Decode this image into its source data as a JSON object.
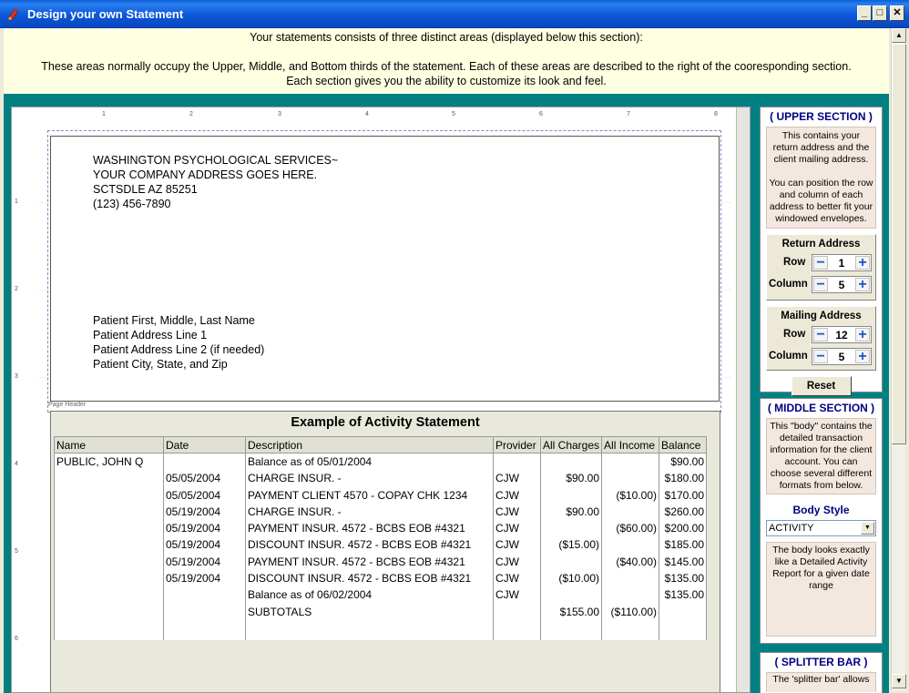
{
  "window": {
    "title": "Design your own Statement",
    "controls": {
      "minimize": "_",
      "maximize": "□",
      "close": "✕"
    }
  },
  "intro": {
    "line1": "Your statements consists of three distinct areas (displayed below this section):",
    "line2": "These areas normally occupy the Upper, Middle, and Bottom thirds of the statement.  Each of these areas are described to the right of the cooresponding section.",
    "line3": "Each section gives you the ability to customize its look and feel."
  },
  "rulers": {
    "horizontal": [
      "1",
      "2",
      "3",
      "4",
      "5",
      "6",
      "7",
      "8"
    ],
    "vertical": [
      "1",
      "2",
      "3",
      "4",
      "5",
      "6"
    ]
  },
  "header": {
    "return_address": [
      "WASHINGTON PSYCHOLOGICAL SERVICES~",
      "YOUR COMPANY ADDRESS GOES HERE.",
      "SCTSDLE AZ 85251",
      "(123) 456-7890"
    ],
    "mailing_address": [
      "Patient First, Middle, Last Name",
      "Patient Address Line 1",
      "Patient Address Line 2 (if needed)",
      "Patient City, State, and Zip"
    ],
    "page_header_label": "Page Header"
  },
  "activity": {
    "title": "Example of Activity Statement",
    "columns": [
      "Name",
      "Date",
      "Description",
      "Provider",
      "All Charges",
      "All Income",
      "Balance"
    ],
    "rows": [
      [
        "PUBLIC, JOHN Q",
        "",
        "Balance as of 05/01/2004",
        "",
        "",
        "",
        "$90.00"
      ],
      [
        "",
        "05/05/2004",
        "CHARGE  INSUR. -",
        "CJW",
        "$90.00",
        "",
        "$180.00"
      ],
      [
        "",
        "05/05/2004",
        "PAYMENT CLIENT 4570 - COPAY CHK 1234",
        "CJW",
        "",
        "($10.00)",
        "$170.00"
      ],
      [
        "",
        "05/19/2004",
        "CHARGE  INSUR. -",
        "CJW",
        "$90.00",
        "",
        "$260.00"
      ],
      [
        "",
        "05/19/2004",
        "PAYMENT INSUR. 4572 - BCBS EOB #4321",
        "CJW",
        "",
        "($60.00)",
        "$200.00"
      ],
      [
        "",
        "05/19/2004",
        "DISCOUNT INSUR. 4572 - BCBS EOB #4321",
        "CJW",
        "($15.00)",
        "",
        "$185.00"
      ],
      [
        "",
        "05/19/2004",
        "PAYMENT INSUR. 4572 - BCBS EOB #4321",
        "CJW",
        "",
        "($40.00)",
        "$145.00"
      ],
      [
        "",
        "05/19/2004",
        "DISCOUNT INSUR. 4572 - BCBS EOB #4321",
        "CJW",
        "($10.00)",
        "",
        "$135.00"
      ],
      [
        "",
        "",
        "Balance as of 06/02/2004",
        "CJW",
        "",
        "",
        "$135.00"
      ],
      [
        "",
        "",
        "SUBTOTALS",
        "",
        "$155.00",
        "($110.00)",
        ""
      ]
    ]
  },
  "upper": {
    "title": "( UPPER SECTION )",
    "desc1": "This contains your return address and the client mailing address.",
    "desc2": "You can position the row and column of each address to better fit your windowed envelopes.",
    "return_address": {
      "title": "Return Address",
      "row_label": "Row",
      "row": "1",
      "col_label": "Column",
      "col": "5"
    },
    "mailing_address": {
      "title": "Mailing Address",
      "row_label": "Row",
      "row": "12",
      "col_label": "Column",
      "col": "5"
    },
    "reset": "Reset"
  },
  "middle": {
    "title": "( MIDDLE SECTION )",
    "desc": "This \"body\" contains the detailed transaction information for the client account.  You can choose several different formats from below.",
    "body_style_label": "Body Style",
    "body_style_value": "ACTIVITY",
    "style_desc": "The body looks exactly like a Detailed Activity Report for a given date range"
  },
  "splitter": {
    "title": "( SPLITTER BAR )",
    "desc": "The 'splitter bar' allows"
  },
  "stepper": {
    "minus": "−",
    "plus": "+"
  },
  "scroll": {
    "up": "▲",
    "down": "▼",
    "drop": "▼"
  }
}
